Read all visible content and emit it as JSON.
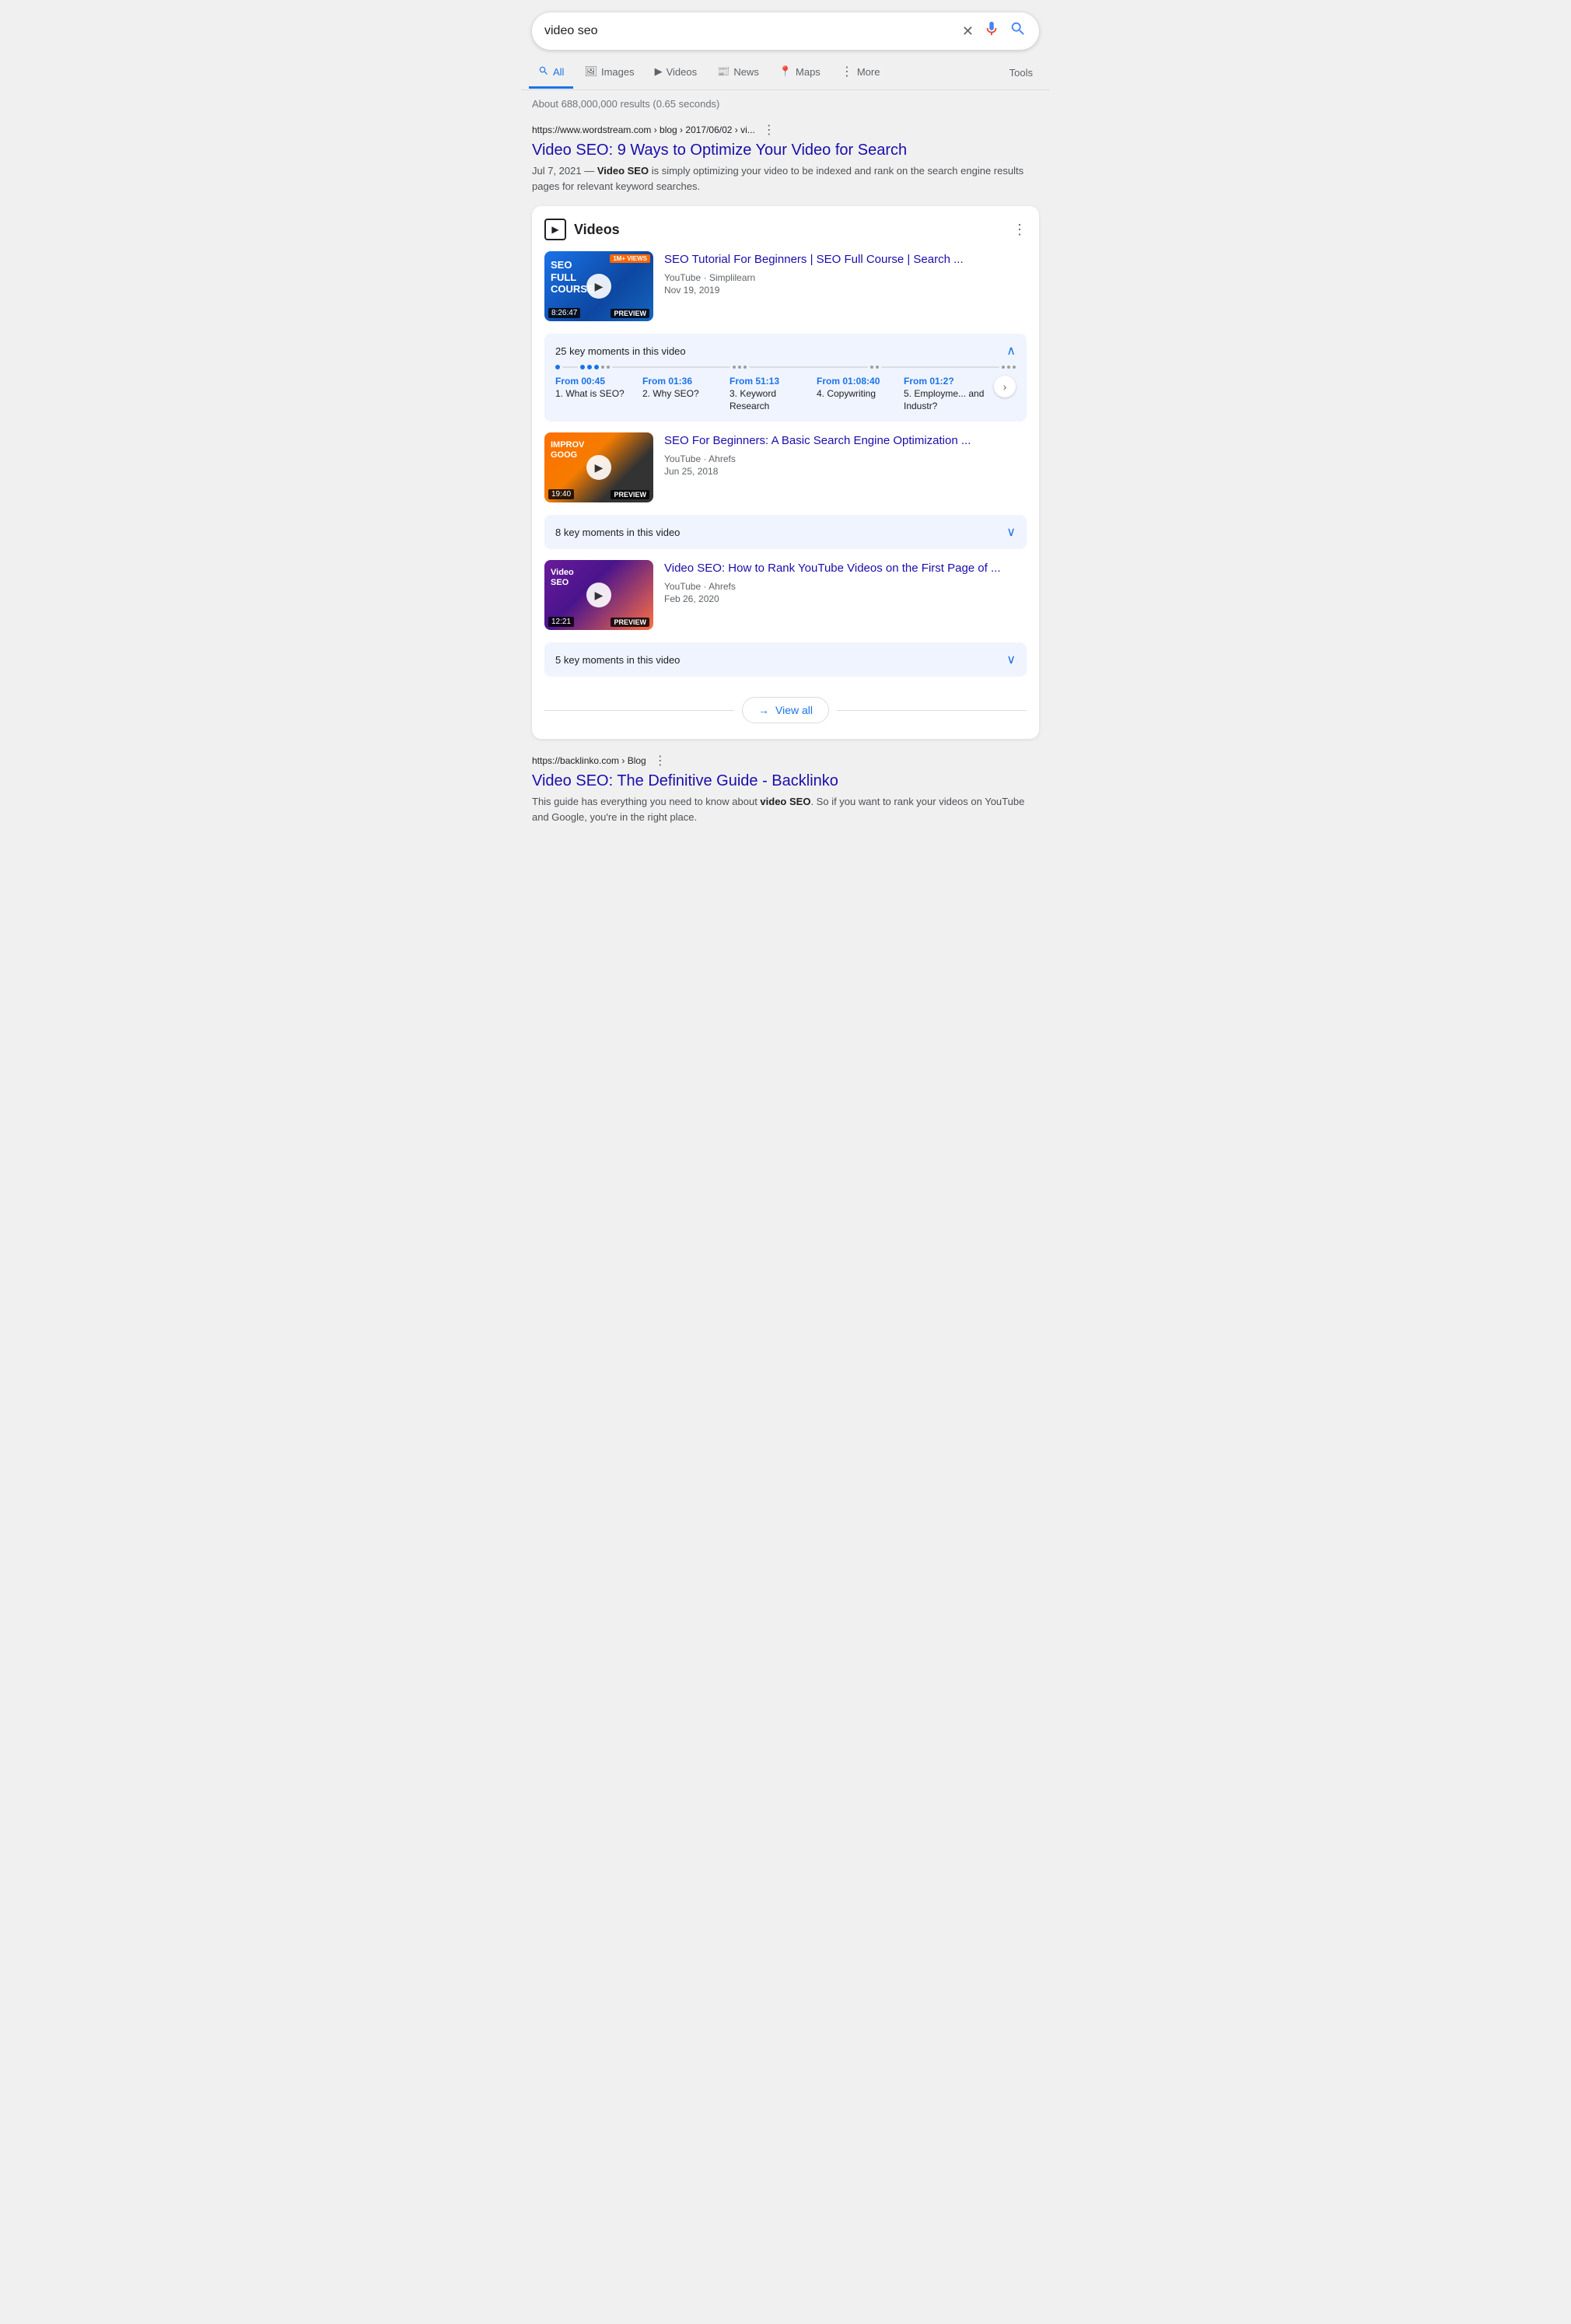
{
  "search": {
    "query": "video seo",
    "placeholder": "video seo",
    "results_info": "About 688,000,000 results (0.65 seconds)"
  },
  "nav": {
    "tabs": [
      {
        "id": "all",
        "label": "All",
        "icon": "🔍",
        "active": true
      },
      {
        "id": "images",
        "label": "Images",
        "icon": "🖼"
      },
      {
        "id": "videos",
        "label": "Videos",
        "icon": "▶"
      },
      {
        "id": "news",
        "label": "News",
        "icon": "📰"
      },
      {
        "id": "maps",
        "label": "Maps",
        "icon": "📍"
      },
      {
        "id": "more",
        "label": "More",
        "icon": "⋮"
      }
    ],
    "tools": "Tools"
  },
  "organic_result_1": {
    "url": "https://www.wordstream.com › blog › 2017/06/02 › vi...",
    "title": "Video SEO: 9 Ways to Optimize Your Video for Search",
    "date": "Jul 7, 2021",
    "snippet": " — Video SEO is simply optimizing your video to be indexed and rank on the search engine results pages for relevant keyword searches."
  },
  "video_card": {
    "header_title": "Videos",
    "videos": [
      {
        "thumb_label": "SEO FULL COURSE",
        "thumb_views": "1M+ VIEWS",
        "duration": "8:26:47",
        "preview": "PREVIEW",
        "title": "SEO Tutorial For Beginners | SEO Full Course | Search ...",
        "source": "YouTube · Simplilearn",
        "date": "Nov 19, 2019",
        "key_moments_label": "25 key moments in this video",
        "key_moments_expanded": true,
        "moments": [
          {
            "time": "From 00:45",
            "label": "1. What is SEO?"
          },
          {
            "time": "From 01:36",
            "label": "2. Why SEO?"
          },
          {
            "time": "From 51:13",
            "label": "3. Keyword Research"
          },
          {
            "time": "From 01:08:40",
            "label": "4. Copywriting"
          },
          {
            "time": "From 01:2?",
            "label": "5. Employme... and Industr?"
          }
        ]
      },
      {
        "thumb_label": "IMPROV GOOG",
        "thumb_views": "",
        "duration": "19:40",
        "preview": "PREVIEW",
        "title": "SEO For Beginners: A Basic Search Engine Optimization ...",
        "source": "YouTube · Ahrefs",
        "date": "Jun 25, 2018",
        "key_moments_label": "8 key moments in this video",
        "key_moments_expanded": false,
        "moments": []
      },
      {
        "thumb_label": "Video SEO",
        "thumb_views": "",
        "duration": "12:21",
        "preview": "PREVIEW",
        "title": "Video SEO: How to Rank YouTube Videos on the First Page of ...",
        "source": "YouTube · Ahrefs",
        "date": "Feb 26, 2020",
        "key_moments_label": "5 key moments in this video",
        "key_moments_expanded": false,
        "moments": []
      }
    ],
    "view_all": "View all"
  },
  "organic_result_2": {
    "url": "https://backlinko.com › Blog",
    "title": "Video SEO: The Definitive Guide - Backlinko",
    "snippet_before": "This guide has everything you need to know about ",
    "snippet_bold": "video SEO",
    "snippet_after": ". So if you want to rank your videos on YouTube and Google, you're in the right place."
  },
  "icons": {
    "close": "✕",
    "mic": "🎤",
    "search": "🔍",
    "more_vert": "⋮",
    "play": "▶",
    "chevron_up": "∧",
    "chevron_down": "∨",
    "arrow_right": "→"
  }
}
